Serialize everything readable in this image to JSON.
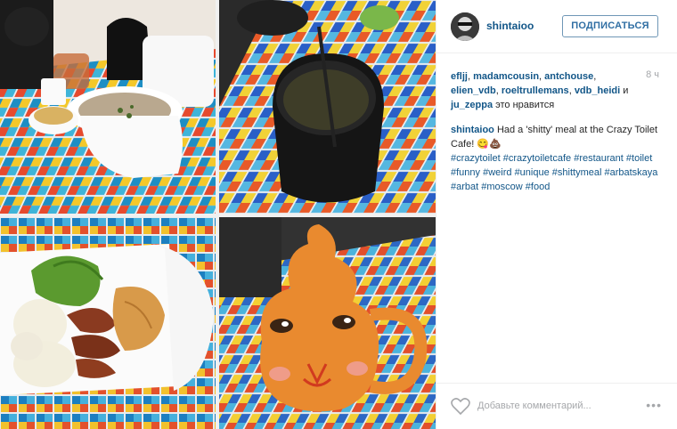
{
  "post": {
    "username": "shintaioo",
    "follow_label": "ПОДПИСАТЬСЯ",
    "time": "8 ч",
    "likes": {
      "users": [
        "eflјј",
        "madamcousin",
        "antchouse",
        "elien_vdb",
        "roeltrullemans",
        "vdb_heidi",
        "ju_zeppa"
      ],
      "sep": ", ",
      "and": " и ",
      "suffix": " это нравится"
    },
    "caption": {
      "author": "shintaioo",
      "text": " Had a 'shitty' meal at the Crazy Toilet Cafe! ",
      "emoji": "😋💩",
      "hashtags": [
        "#crazytoilet",
        "#crazytoiletcafe",
        "#restaurant",
        "#toilet",
        "#funny",
        "#weird",
        "#unique",
        "#shittymeal",
        "#arbatskaya",
        "#arbat",
        "#moscow",
        "#food"
      ]
    },
    "comment_placeholder": "Добавьте комментарий...",
    "more_label": "•••"
  },
  "colors": {
    "link": "#125688",
    "follow_border": "#6f97b6",
    "muted": "#a5a7aa",
    "text": "#262626"
  },
  "icons": {
    "like": "heart-outline-icon",
    "more": "ellipsis-icon"
  }
}
